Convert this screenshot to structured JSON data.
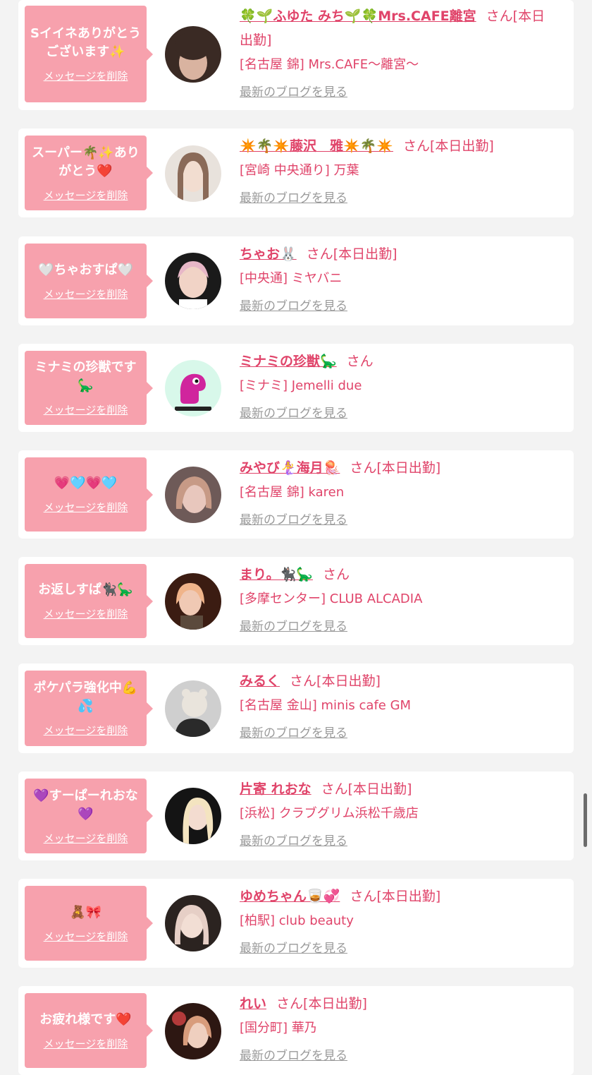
{
  "delete_label": "メッセージを削除",
  "blog_label": "最新のブログを見る",
  "san": "さん",
  "colors": {
    "bubble": "#f7a1ad",
    "accent": "#e0446a",
    "link_gray": "#9a9a9a",
    "background": "#f3f3f3"
  },
  "messages": [
    {
      "bubble": "Sイイネありがとうございます✨",
      "name": "🍀🌱ふゆた みち🌱🍀Mrs.CAFE離宮",
      "status": "[本日出勤]",
      "shop": "[名古屋 錦] Mrs.CAFE〜離宮〜",
      "avatar_icon": "avatar-photo-icon",
      "avatar_colors": [
        "#3a2a24",
        "#d9b3a0"
      ]
    },
    {
      "bubble": "スーパー🌴✨ありがとう❤️",
      "name": "✴️🌴✴️藤沢　雅✴️🌴✴️",
      "status": "[本日出勤]",
      "shop": "[宮崎 中央通り] 万葉",
      "avatar_icon": "avatar-photo-icon",
      "avatar_colors": [
        "#e8e2dc",
        "#8a6a58"
      ]
    },
    {
      "bubble": "🤍ちゃおすぱ🤍",
      "name": "ちゃお🐰",
      "status": "[本日出勤]",
      "shop": "[中央通] ミヤバニ",
      "avatar_icon": "avatar-photo-icon",
      "avatar_colors": [
        "#1a1a1a",
        "#e7b7c7"
      ]
    },
    {
      "bubble": "ミナミの珍獣です🦕",
      "name": "ミナミの珍獣🦕",
      "status": "",
      "shop": "[ミナミ] Jemelli due",
      "avatar_icon": "dinosaur-icon",
      "avatar_colors": [
        "#d8f8ea",
        "#d0259d"
      ]
    },
    {
      "bubble": "💗🩵💗🩵",
      "name": "みやび🧜‍♀️海月🪼",
      "status": "[本日出勤]",
      "shop": "[名古屋 錦] karen",
      "avatar_icon": "avatar-photo-icon",
      "avatar_colors": [
        "#6e5a58",
        "#e8c7bd"
      ]
    },
    {
      "bubble": "お返しすぱ🐈‍⬛🦕",
      "name": "まり。🐈‍⬛🦕",
      "status": "",
      "shop": "[多摩センター] CLUB ALCADIA",
      "avatar_icon": "avatar-photo-icon",
      "avatar_colors": [
        "#3b1c12",
        "#f0b48a"
      ]
    },
    {
      "bubble": "ポケパラ強化中💪💦",
      "name": "みるく",
      "status": "[本日出勤]",
      "shop": "[名古屋 金山] minis cafe GM",
      "avatar_icon": "avatar-photo-icon",
      "avatar_colors": [
        "#cfcfcf",
        "#2a2a2a"
      ]
    },
    {
      "bubble": "💜すーぱーれおな💜",
      "name": "片寄 れおな",
      "status": "[本日出勤]",
      "shop": "[浜松] クラブグリム浜松千歳店",
      "avatar_icon": "avatar-photo-icon",
      "avatar_colors": [
        "#141414",
        "#f4e4c0"
      ]
    },
    {
      "bubble": "🧸🎀",
      "name": "ゆめちゃん🥃💞",
      "status": "[本日出勤]",
      "shop": "[柏駅] club beauty",
      "avatar_icon": "avatar-photo-icon",
      "avatar_colors": [
        "#2b2320",
        "#e6cfc6"
      ]
    },
    {
      "bubble": "お疲れ様です❤️",
      "name": "れい",
      "status": "[本日出勤]",
      "shop": "[国分町] 華乃",
      "avatar_icon": "avatar-photo-icon",
      "avatar_colors": [
        "#2d1712",
        "#d89c7c"
      ]
    }
  ]
}
